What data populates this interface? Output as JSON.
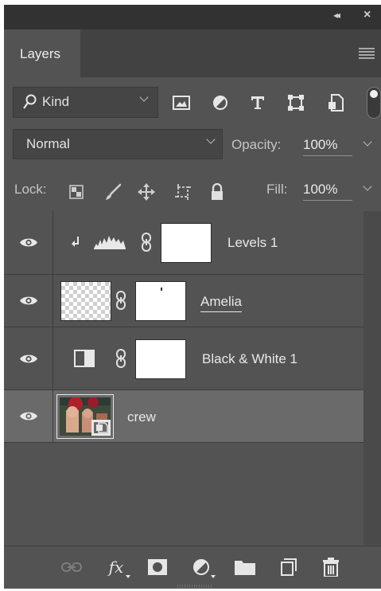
{
  "panel": {
    "collapse_icon": "double-chevron-left-icon",
    "close_icon": "close-icon",
    "tab_label": "Layers",
    "menu_icon": "hamburger-menu-icon"
  },
  "filter": {
    "kind_label": "Kind",
    "icons": [
      "pixel-layer-filter-icon",
      "adjustment-layer-filter-icon",
      "type-layer-filter-icon",
      "shape-layer-filter-icon",
      "smart-object-filter-icon"
    ]
  },
  "blend": {
    "mode": "Normal",
    "opacity_label": "Opacity:",
    "opacity_value": "100%"
  },
  "lock": {
    "label": "Lock:",
    "icons": [
      "lock-transparent-pixels-icon",
      "lock-image-pixels-icon",
      "lock-position-icon",
      "lock-artboard-icon",
      "lock-all-icon"
    ],
    "fill_label": "Fill:",
    "fill_value": "100%"
  },
  "layers": [
    {
      "name": "Levels 1",
      "type": "adjustment-levels",
      "clipped": true,
      "visible": true
    },
    {
      "name": "Amelia",
      "type": "pixel-with-mask",
      "visible": true
    },
    {
      "name": "Black & White 1",
      "type": "adjustment-black-white",
      "visible": true
    },
    {
      "name": "crew",
      "type": "smart-object",
      "visible": true,
      "selected": true
    }
  ],
  "bottom_icons": [
    "link-layers-icon",
    "layer-style-fx-icon",
    "add-mask-icon",
    "new-adjustment-layer-icon",
    "new-group-folder-icon",
    "new-layer-icon",
    "delete-trash-icon"
  ],
  "bottom_fx_text": "fx",
  "colors": {
    "panel": "#535353",
    "titlebar": "#323232",
    "selected_row": "#6a6a6a"
  }
}
